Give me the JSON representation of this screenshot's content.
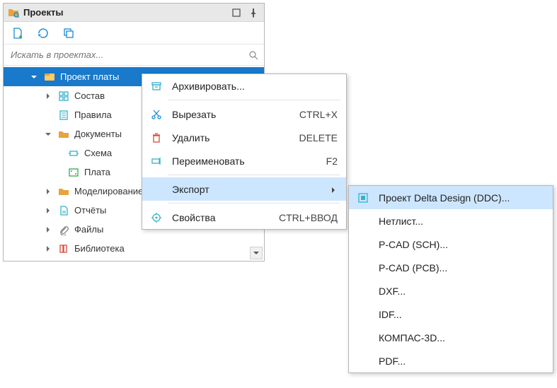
{
  "panel": {
    "title": "Проекты",
    "search_placeholder": "Искать в проектах..."
  },
  "tree": {
    "project": "Проект платы",
    "composition": "Состав",
    "rules": "Правила",
    "documents": "Документы",
    "schematic": "Схема",
    "board": "Плата",
    "modeling": "Моделирование",
    "reports": "Отчёты",
    "files": "Файлы",
    "library": "Библиотека"
  },
  "ctx": {
    "archive": "Архивировать...",
    "cut": "Вырезать",
    "delete": "Удалить",
    "rename": "Переименовать",
    "export": "Экспорт",
    "properties": "Свойства",
    "sc_cut": "CTRL+X",
    "sc_delete": "DELETE",
    "sc_rename": "F2",
    "sc_props": "CTRL+ВВОД"
  },
  "sub": {
    "ddc": "Проект Delta Design (DDC)...",
    "netlist": "Нетлист...",
    "pcad_sch": "P-CAD (SCH)...",
    "pcad_pcb": "P-CAD (PCB)...",
    "dxf": "DXF...",
    "idf": "IDF...",
    "kompas": "КОМПАС-3D...",
    "pdf": "PDF..."
  }
}
